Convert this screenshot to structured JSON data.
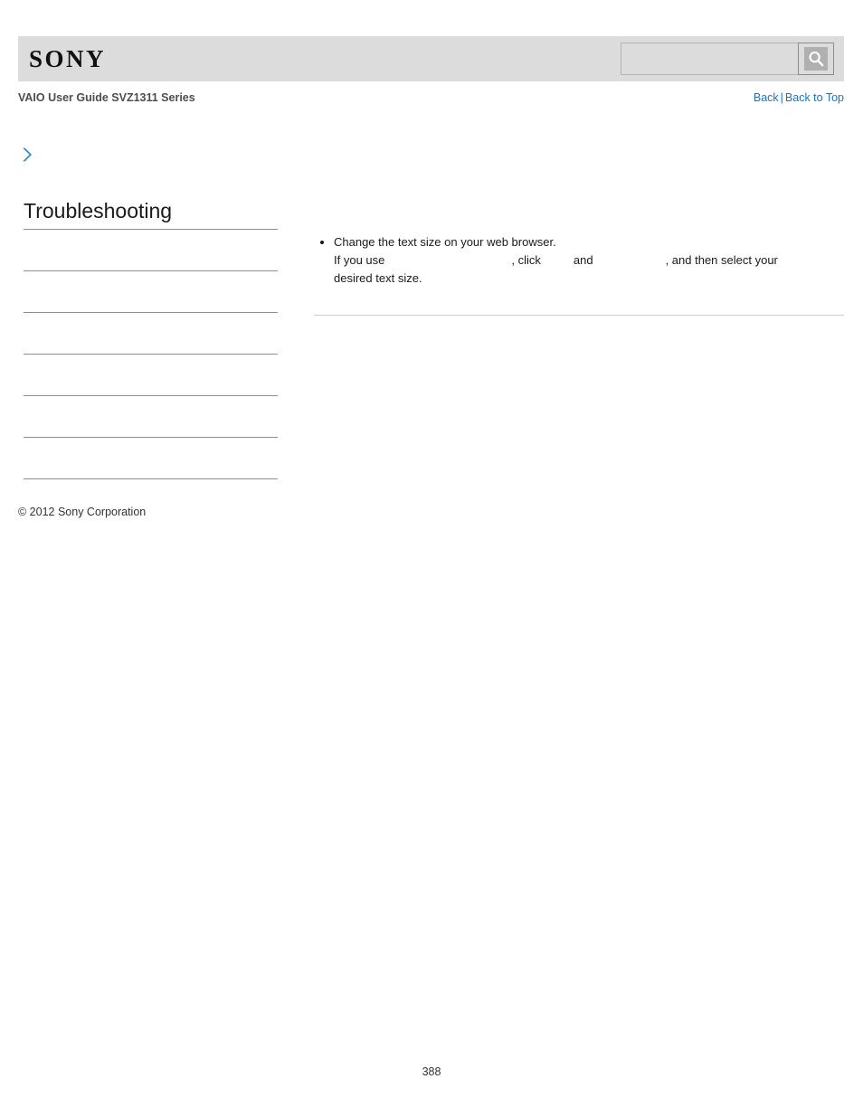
{
  "header": {
    "logo_text": "SONY",
    "search": {
      "value": "",
      "placeholder": "",
      "icon": "search-icon",
      "button_label": ""
    }
  },
  "subheader": {
    "guide_title": "VAIO User Guide SVZ1311 Series",
    "links": {
      "back": "Back",
      "separator": "|",
      "back_to_top": "Back to Top"
    }
  },
  "breadcrumb": {
    "icon": "chevron-right-icon",
    "text": ""
  },
  "sidebar": {
    "title": "Troubleshooting",
    "items": [
      {
        "label": ""
      },
      {
        "label": ""
      },
      {
        "label": ""
      },
      {
        "label": ""
      },
      {
        "label": ""
      },
      {
        "label": ""
      }
    ]
  },
  "main": {
    "bullets": [
      {
        "line1": "Change the text size on your web browser.",
        "line2_a": "If you use",
        "blank_app": "",
        "line2_b": ", click",
        "blank_menu1": "",
        "line2_c": "and",
        "blank_menu2": "",
        "line2_d": ", and then select your",
        "line3": "desired text size."
      }
    ]
  },
  "footer": {
    "copyright": "© 2012 Sony Corporation",
    "page_number": "388"
  },
  "colors": {
    "header_bg": "#dcdcdc",
    "link_blue": "#1a73c8",
    "chevron_blue": "#2b87c8",
    "rule_gray": "#8f8f8f",
    "content_rule_gray": "#cccccc",
    "text_dark": "#1a1a1a",
    "text_muted": "#4d4d4d"
  }
}
